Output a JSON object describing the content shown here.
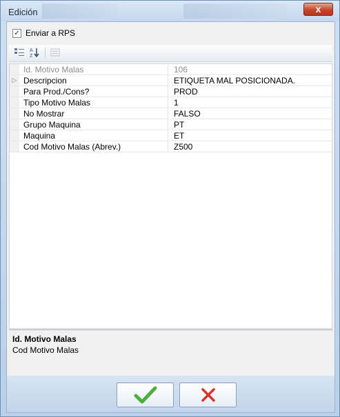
{
  "window": {
    "title": "Edición",
    "close_glyph": "x"
  },
  "checkbox": {
    "label": "Enviar a RPS",
    "checked": true
  },
  "toolbar": {
    "items": [
      "categorized-icon",
      "alphabetical-sort-icon",
      "property-pages-icon"
    ]
  },
  "properties": [
    {
      "name": "Id. Motivo Malas",
      "value": "106",
      "readonly": true,
      "expandable": false
    },
    {
      "name": "Descripcion",
      "value": "ETIQUETA MAL POSICIONADA.",
      "readonly": false,
      "expandable": true
    },
    {
      "name": "Para Prod./Cons?",
      "value": "PROD",
      "readonly": false,
      "expandable": false
    },
    {
      "name": "Tipo Motivo Malas",
      "value": "1",
      "readonly": false,
      "expandable": false
    },
    {
      "name": "No Mostrar",
      "value": "FALSO",
      "readonly": false,
      "expandable": false
    },
    {
      "name": "Grupo Maquina",
      "value": "PT",
      "readonly": false,
      "expandable": false
    },
    {
      "name": "Maquina",
      "value": "ET",
      "readonly": false,
      "expandable": false
    },
    {
      "name": "Cod Motivo Malas (Abrev.)",
      "value": "Z500",
      "readonly": false,
      "expandable": false
    }
  ],
  "description": {
    "title": "Id. Motivo Malas",
    "text": "Cod Motivo Malas"
  },
  "buttons": {
    "ok_icon": "checkmark-icon",
    "cancel_icon": "cross-icon"
  },
  "colors": {
    "ok": "#4caf3c",
    "cancel": "#d8332a",
    "close": "#c6452c"
  }
}
